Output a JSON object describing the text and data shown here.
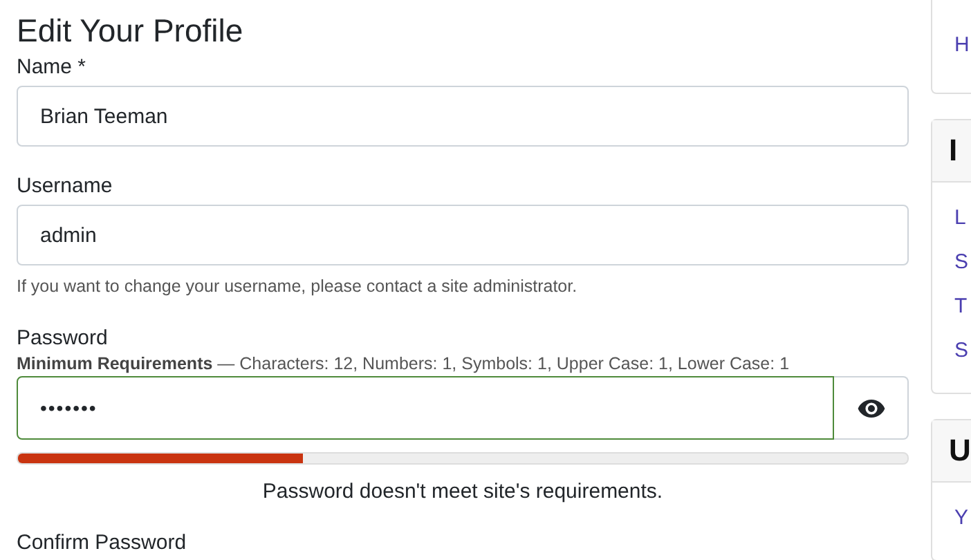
{
  "page_title": "Edit Your Profile",
  "fields": [
    {
      "kind": "text",
      "label": "Name *",
      "value": "Brian Teeman"
    },
    {
      "kind": "text",
      "label": "Username",
      "value": "admin",
      "help": "If you want to change your username, please contact a site administrator."
    },
    {
      "kind": "password",
      "label": "Password",
      "requirements": "**Minimum Requirements** — Characters: 12, Numbers: 1, Symbols: 1, Upper Case: 1, Lower Case: 1",
      "value": "•••••••",
      "valid": true,
      "meter": {
        "level": 0.32,
        "message": "Password doesn't meet site's requirements."
      }
    },
    {
      "kind": "cut",
      "label": "Confirm Password"
    }
  ],
  "sidebar": [
    {
      "links": [
        "H"
      ]
    },
    {
      "header": "I",
      "links": [
        "L",
        "S",
        "T",
        "S"
      ]
    },
    {
      "header": "U",
      "links": [
        "Y"
      ]
    }
  ]
}
